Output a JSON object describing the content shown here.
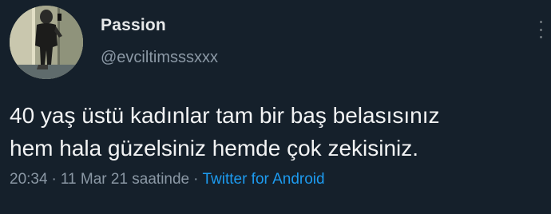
{
  "author": {
    "display_name": "Passion",
    "handle": "@evciltimsssxxx"
  },
  "tweet": {
    "text_lines": [
      "40 yaş üstü kadınlar tam bir baş belasısınız",
      "hem hala güzelsiniz hemde çok zekisiniz."
    ]
  },
  "meta": {
    "time": "20:34",
    "separator": "·",
    "date": "11 Mar 21 saatinde",
    "source": "Twitter for Android"
  },
  "icons": {
    "more": "more-options-icon",
    "avatar": "profile-photo"
  }
}
